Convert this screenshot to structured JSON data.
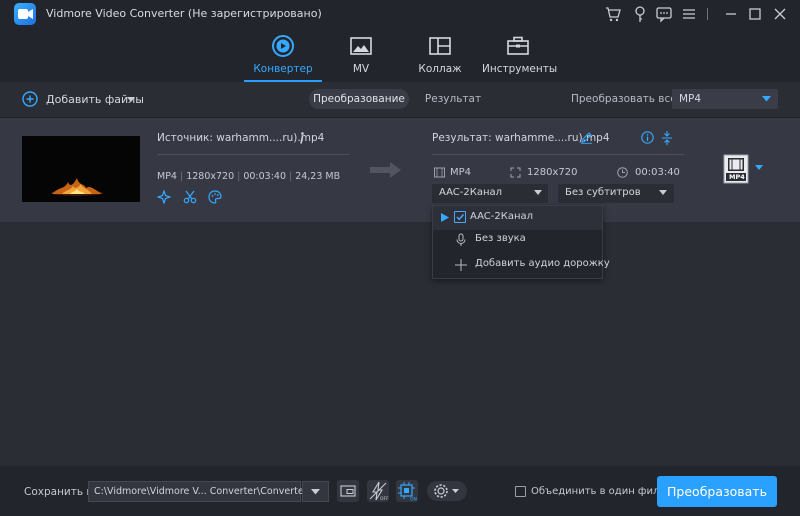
{
  "window": {
    "title": "Vidmore Video Converter  (Не зарегистрировано)"
  },
  "nav": {
    "tabs": [
      {
        "label": "Конвертер",
        "icon": "converter-icon",
        "active": true
      },
      {
        "label": "MV",
        "icon": "mv-icon"
      },
      {
        "label": "Коллаж",
        "icon": "collage-icon"
      },
      {
        "label": "Инструменты",
        "icon": "toolbox-icon"
      }
    ]
  },
  "toolbar": {
    "add_files": "Добавить файлы",
    "segments": [
      "Преобразование",
      "Результат"
    ],
    "convert_all_label": "Преобразовать все в:",
    "convert_all_value": "MP4"
  },
  "file": {
    "source_label": "Источник: warhamm....ru).mp4",
    "meta": [
      "MP4",
      "1280x720",
      "00:03:40",
      "24,23 MB"
    ],
    "result_label": "Результат: warhamme....ru).mp4",
    "result_format": "MP4",
    "result_resolution": "1280x720",
    "result_duration": "00:03:40",
    "audio_value": "AAC-2Канал",
    "subtitle_value": "Без субтитров",
    "format_badge": "MP4"
  },
  "audio_dropdown": {
    "items": [
      "AAC-2Канал",
      "Без звука",
      "Добавить аудио дорожку"
    ]
  },
  "bottom": {
    "save_label": "Сохранить в:",
    "save_path": "C:\\Vidmore\\Vidmore V... Converter\\Converted",
    "merge_label": "Объединить в один фильм",
    "convert_button": "Преобразовать"
  },
  "colors": {
    "accent": "#2aa0ff",
    "background": "#2b2d35",
    "row": "#363944"
  }
}
